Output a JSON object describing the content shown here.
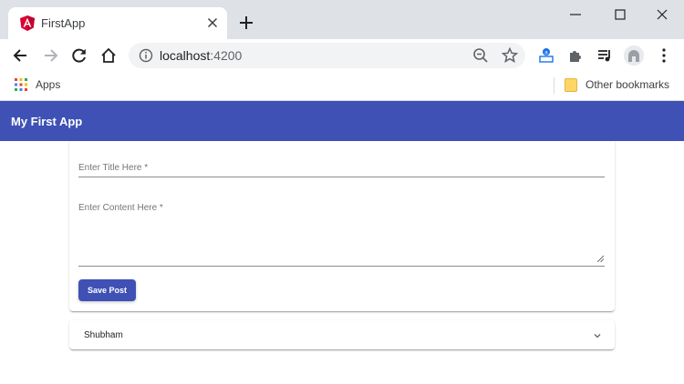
{
  "browser": {
    "tab": {
      "title": "FirstApp",
      "favicon": "angular-icon"
    },
    "address": {
      "host": "localhost",
      "port": ":4200"
    },
    "bookmarks": {
      "apps_label": "Apps",
      "other_label": "Other bookmarks"
    }
  },
  "app": {
    "header_title": "My First App",
    "form": {
      "title_placeholder": "Enter Title Here *",
      "content_placeholder": "Enter Content Here *",
      "save_label": "Save Post"
    },
    "posts": [
      {
        "title": "Shubham"
      }
    ]
  },
  "colors": {
    "primary": "#3f51b5",
    "tabstrip": "#dee1e6",
    "omnibox": "#f1f3f4"
  }
}
